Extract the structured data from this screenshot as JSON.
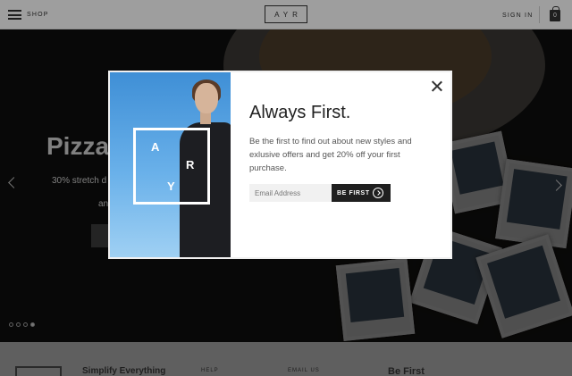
{
  "header": {
    "menu_icon": "hamburger-icon",
    "shop_label": "SHOP",
    "logo": "AYR",
    "signin_label": "SIGN IN",
    "bag_count": "0",
    "bag_icon": "shopping-bag-icon"
  },
  "hero": {
    "title": "Pizza",
    "subtitle": "30% stretch d",
    "subtitle2": "an",
    "slides": 4,
    "active_slide": 4
  },
  "footer": {
    "simplify": "Simplify Everything",
    "help": "HELP",
    "email_us": "EMAIL US",
    "be_first": "Be First"
  },
  "modal": {
    "image_logo": [
      "A",
      "R",
      "Y"
    ],
    "title": "Always First.",
    "text": "Be the first to find out about new styles and exlusive offers and get 20% off your first purchase.",
    "email_placeholder": "Email Address",
    "button_label": "BE FIRST",
    "close_icon": "close-icon"
  },
  "colors": {
    "overlay": "#000000",
    "button": "#1f1f1f",
    "sky": "#6ab1ea"
  }
}
